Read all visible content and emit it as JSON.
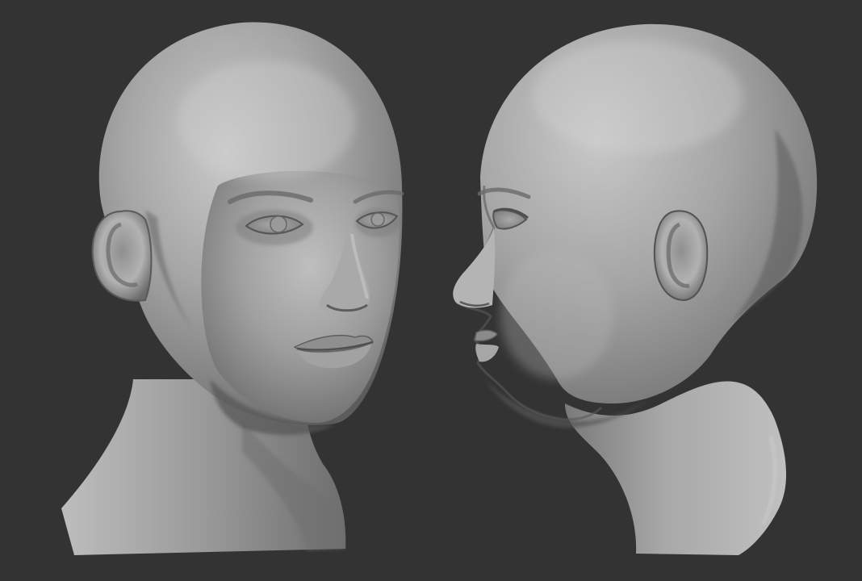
{
  "scene": {
    "background": "#333333",
    "clay_light": "#c4c4c4",
    "clay_mid": "#8e8e8e",
    "clay_dark": "#4a4a4a",
    "views": [
      {
        "name": "three-quarter-view",
        "icon": "head-sculpt-three-quarter"
      },
      {
        "name": "profile-view",
        "icon": "head-sculpt-profile"
      }
    ]
  }
}
